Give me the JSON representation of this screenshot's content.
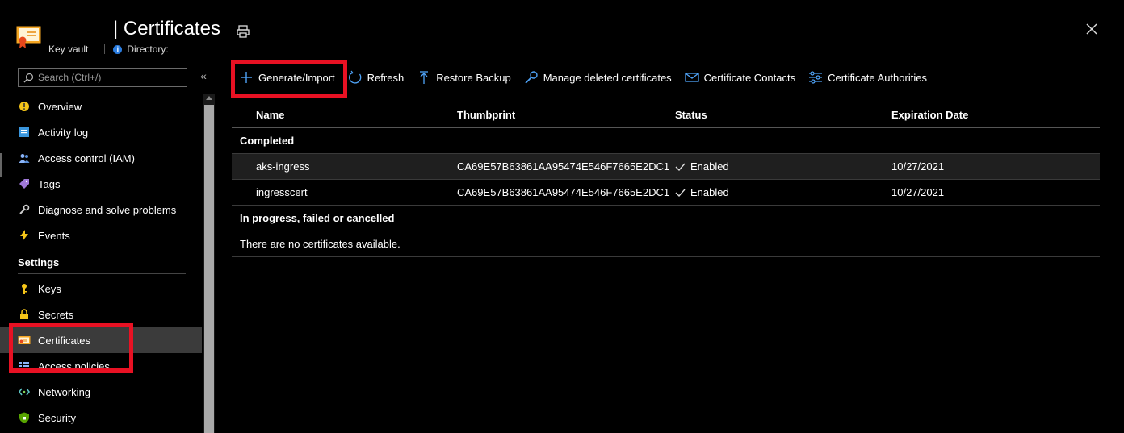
{
  "header": {
    "title": "| Certificates",
    "resource_type": "Key vault",
    "directory_label": "Directory:"
  },
  "sidebar": {
    "search_placeholder": "Search (Ctrl+/)",
    "collapse_label": "«",
    "items": [
      {
        "label": "Overview",
        "icon": "overview-icon"
      },
      {
        "label": "Activity log",
        "icon": "activity-log-icon"
      },
      {
        "label": "Access control (IAM)",
        "icon": "iam-icon"
      },
      {
        "label": "Tags",
        "icon": "tag-icon"
      },
      {
        "label": "Diagnose and solve problems",
        "icon": "wrench-icon"
      },
      {
        "label": "Events",
        "icon": "lightning-icon"
      }
    ],
    "settings_header": "Settings",
    "settings_items": [
      {
        "label": "Keys",
        "icon": "key-icon"
      },
      {
        "label": "Secrets",
        "icon": "secret-icon"
      },
      {
        "label": "Certificates",
        "icon": "certificate-icon",
        "active": true
      },
      {
        "label": "Access policies",
        "icon": "access-policies-icon"
      },
      {
        "label": "Networking",
        "icon": "networking-icon"
      },
      {
        "label": "Security",
        "icon": "shield-icon"
      }
    ]
  },
  "toolbar": {
    "generate_import": "Generate/Import",
    "refresh": "Refresh",
    "restore_backup": "Restore Backup",
    "manage_deleted": "Manage deleted certificates",
    "contacts": "Certificate Contacts",
    "authorities": "Certificate Authorities"
  },
  "table": {
    "columns": [
      "Name",
      "Thumbprint",
      "Status",
      "Expiration Date"
    ],
    "group_completed": "Completed",
    "rows": [
      {
        "name": "aks-ingress",
        "thumbprint": "CA69E57B63861AA95474E546F7665E2DC1...",
        "status": "Enabled",
        "expiration": "10/27/2021"
      },
      {
        "name": "ingresscert",
        "thumbprint": "CA69E57B63861AA95474E546F7665E2DC1...",
        "status": "Enabled",
        "expiration": "10/27/2021"
      }
    ],
    "group_inprogress": "In progress, failed or cancelled",
    "empty_message": "There are no certificates available."
  },
  "colors": {
    "background": "#000000",
    "accent": "#2a7de1",
    "highlight": "#e81123",
    "active_item": "#3b3b3b"
  }
}
